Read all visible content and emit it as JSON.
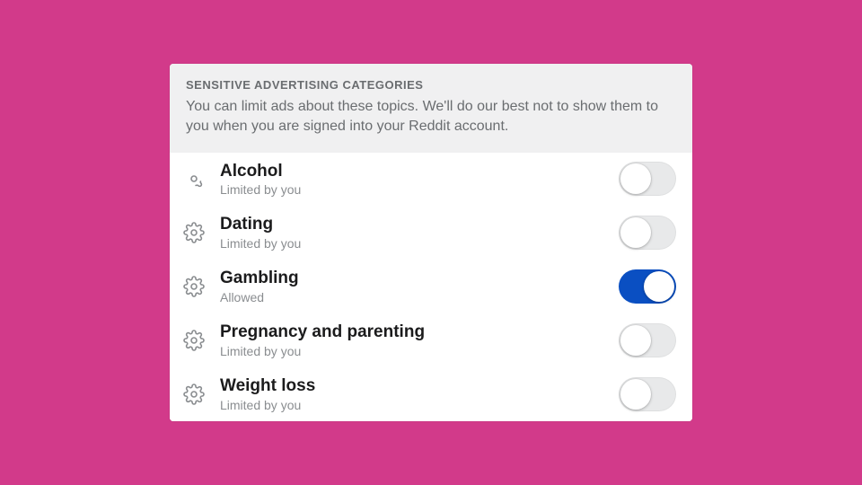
{
  "header": {
    "title": "SENSITIVE ADVERTISING CATEGORIES",
    "description": "You can limit ads about these topics. We'll do our best not to show them to you when you are signed into your Reddit account."
  },
  "status_labels": {
    "limited": "Limited by you",
    "allowed": "Allowed"
  },
  "categories": [
    {
      "name": "Alcohol",
      "status": "Limited by you",
      "enabled": false
    },
    {
      "name": "Dating",
      "status": "Limited by you",
      "enabled": false
    },
    {
      "name": "Gambling",
      "status": "Allowed",
      "enabled": true
    },
    {
      "name": "Pregnancy and parenting",
      "status": "Limited by you",
      "enabled": false
    },
    {
      "name": "Weight loss",
      "status": "Limited by you",
      "enabled": false
    }
  ],
  "colors": {
    "background": "#d23a8a",
    "toggle_on": "#0a4fc2"
  }
}
